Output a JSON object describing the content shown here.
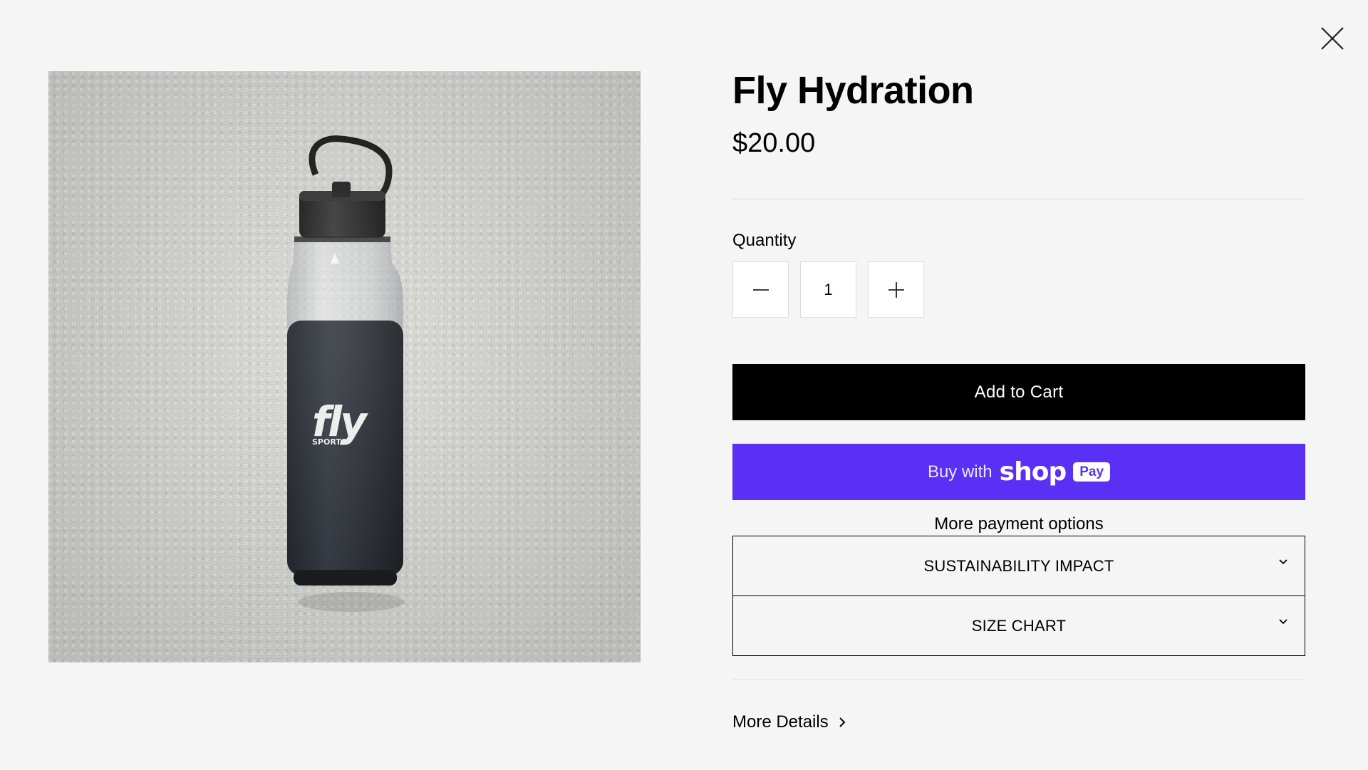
{
  "close": {
    "icon": "close-icon"
  },
  "product": {
    "title": "Fly Hydration",
    "price": "$20.00",
    "image_alt": "Black Fly Sports water bottle on concrete",
    "brand_mark": "fly",
    "brand_sub": "SPORTS"
  },
  "quantity": {
    "label": "Quantity",
    "value": "1",
    "minus_icon": "minus-icon",
    "plus_icon": "plus-icon"
  },
  "actions": {
    "add_to_cart": "Add to Cart",
    "buy_with": "Buy with",
    "shop_word": "shop",
    "pay_badge": "Pay",
    "more_payment": "More payment options"
  },
  "accordions": [
    {
      "label": "SUSTAINABILITY IMPACT",
      "icon": "chevron-down-icon"
    },
    {
      "label": "SIZE CHART",
      "icon": "chevron-down-icon"
    }
  ],
  "more_details": {
    "label": "More Details",
    "icon": "chevron-right-icon"
  },
  "colors": {
    "background": "#f5f5f5",
    "cart_button": "#000000",
    "shop_pay": "#5a31f4",
    "divider": "#dcdcdc"
  }
}
